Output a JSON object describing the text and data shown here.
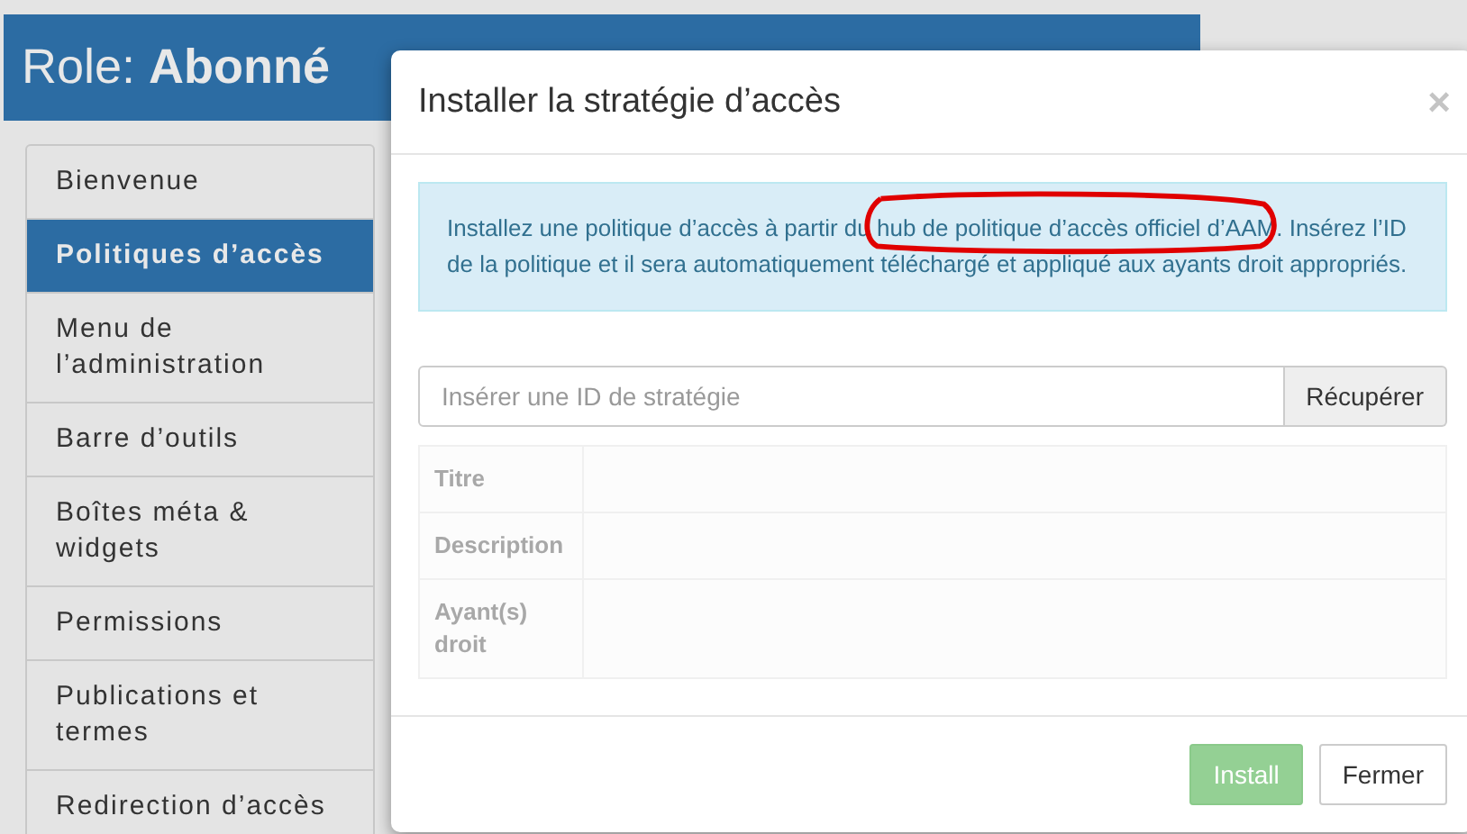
{
  "page": {
    "role_label": "Role:",
    "role_name": "Abonné"
  },
  "sidebar": {
    "items": [
      {
        "label": "Bienvenue",
        "selected": false
      },
      {
        "label": "Politiques d’accès",
        "selected": true
      },
      {
        "label": "Menu de l’administration",
        "selected": false
      },
      {
        "label": "Barre d’outils",
        "selected": false
      },
      {
        "label": "Boîtes méta & widgets",
        "selected": false
      },
      {
        "label": "Permissions",
        "selected": false
      },
      {
        "label": "Publications et termes",
        "selected": false
      },
      {
        "label": "Redirection d’accès",
        "selected": false
      }
    ]
  },
  "modal": {
    "title": "Installer la stratégie d’accès",
    "close": "×",
    "alert": {
      "before": "Installez une politique d’accès à partir du ",
      "link": "hub de politique d’accès officiel d’AAM",
      "after": ". Insérez l’ID de la politique et il sera automatiquement téléchargé et appliqué aux ayants droit appropriés.",
      "annotated": true
    },
    "id_field": {
      "placeholder": "Insérer une ID de stratégie"
    },
    "fetch_button": "Récupérer",
    "details": [
      {
        "label": "Titre"
      },
      {
        "label": "Description"
      },
      {
        "label": "Ayant(s) droit"
      }
    ],
    "buttons": [
      {
        "label": "Install",
        "kind": "primary",
        "disabled": true
      },
      {
        "label": "Fermer",
        "kind": "default",
        "disabled": false
      }
    ]
  }
}
